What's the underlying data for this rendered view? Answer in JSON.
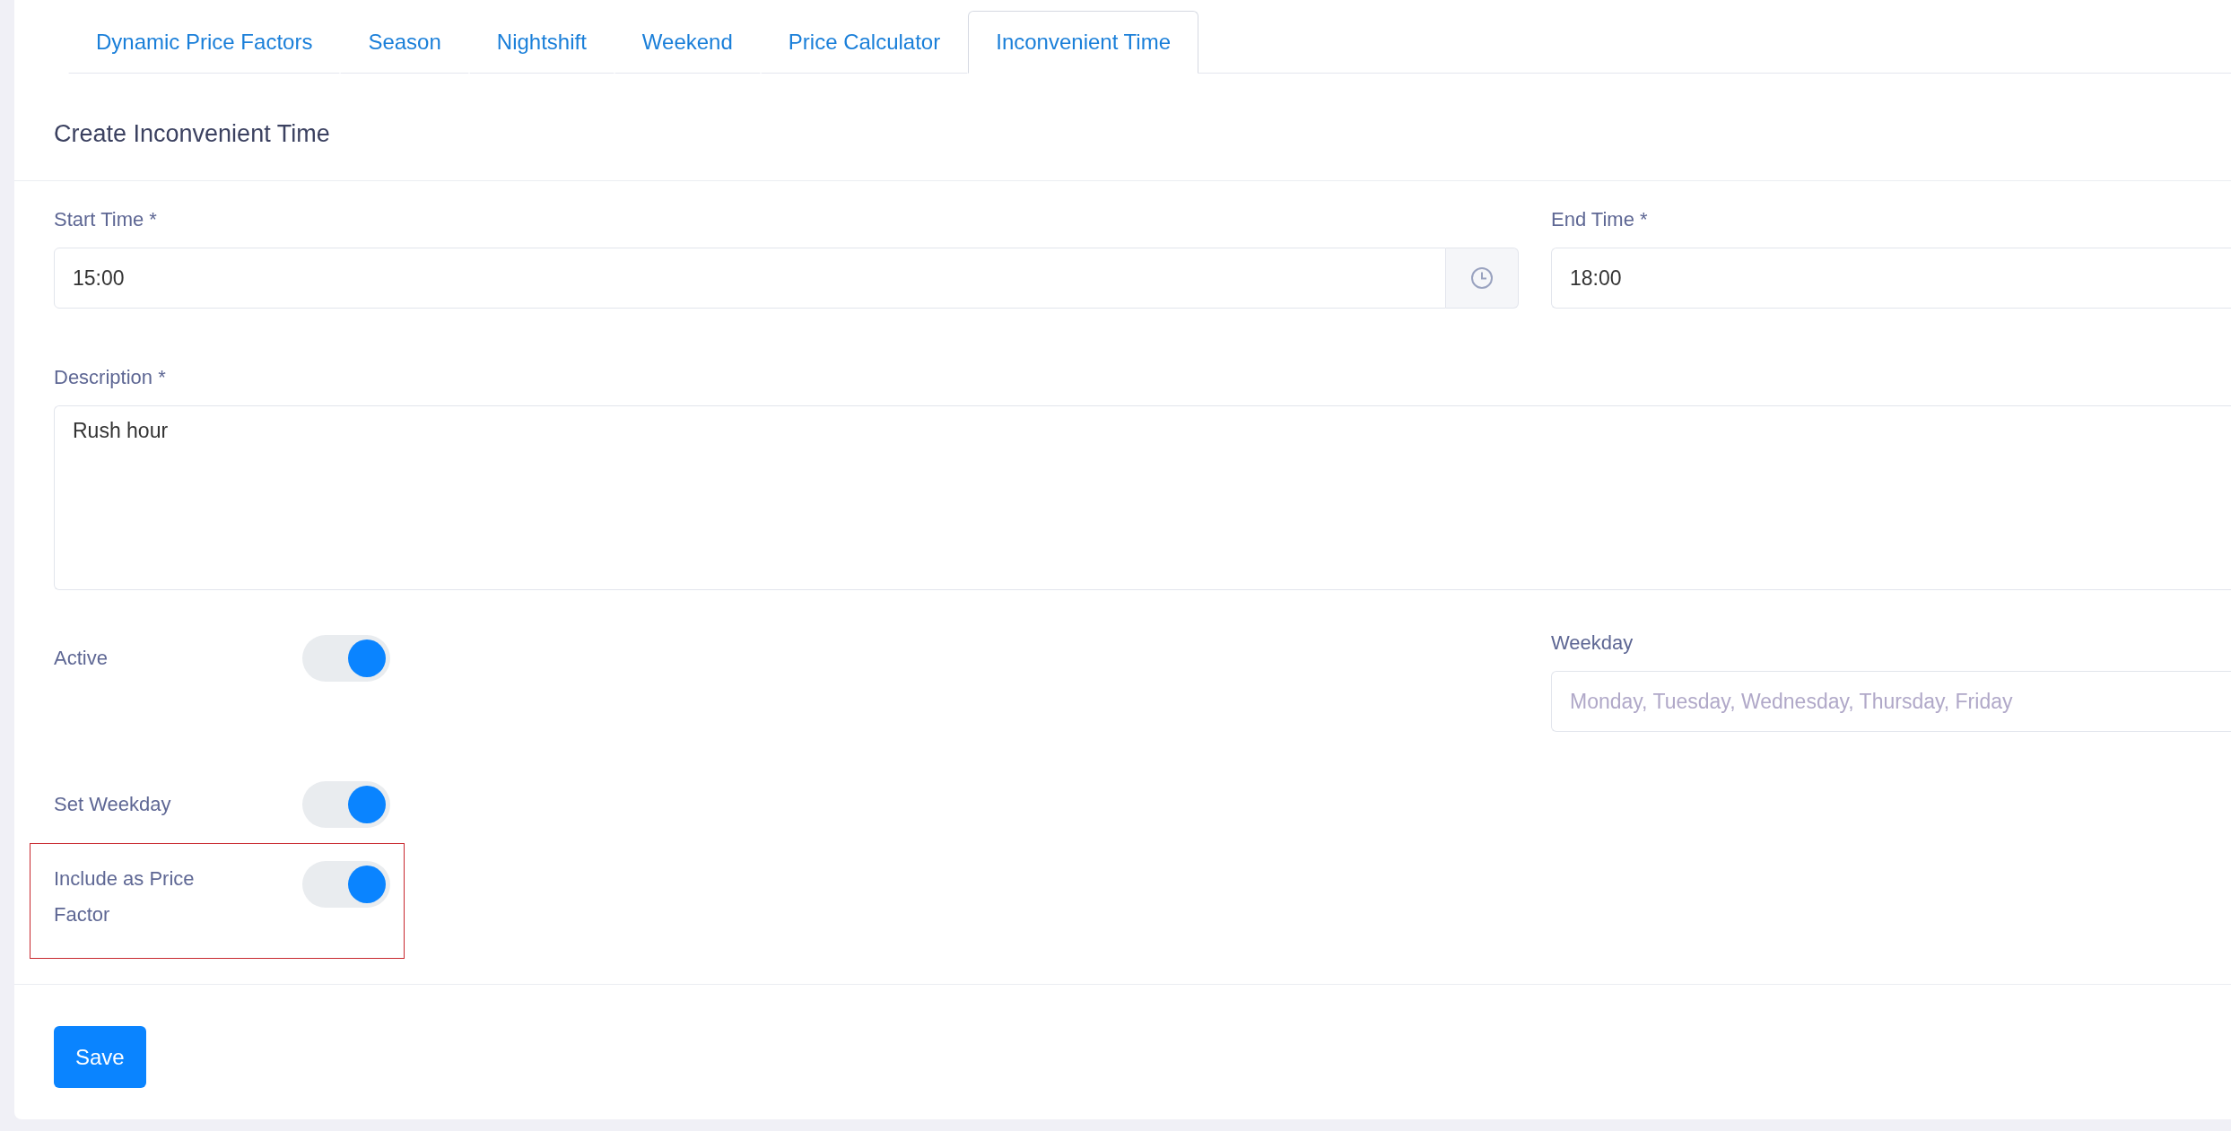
{
  "tabs": [
    {
      "label": "Dynamic Price Factors",
      "selected": false
    },
    {
      "label": "Season",
      "selected": false
    },
    {
      "label": "Nightshift",
      "selected": false
    },
    {
      "label": "Weekend",
      "selected": false
    },
    {
      "label": "Price Calculator",
      "selected": false
    },
    {
      "label": "Inconvenient Time",
      "selected": true
    }
  ],
  "heading": "Create Inconvenient Time",
  "start_time": {
    "label": "Start Time *",
    "value": "15:00"
  },
  "end_time": {
    "label": "End Time *",
    "value": "18:00"
  },
  "description": {
    "label": "Description *",
    "value": "Rush hour"
  },
  "toggles": [
    {
      "label": "Active",
      "on": true,
      "highlighted": false
    },
    {
      "label": "Set Weekday",
      "on": true,
      "highlighted": false
    },
    {
      "label": "Include as Price Factor",
      "on": true,
      "highlighted": true
    }
  ],
  "weekday": {
    "label": "Weekday",
    "placeholder": "Monday, Tuesday, Wednesday, Thursday, Friday"
  },
  "save_button": "Save"
}
